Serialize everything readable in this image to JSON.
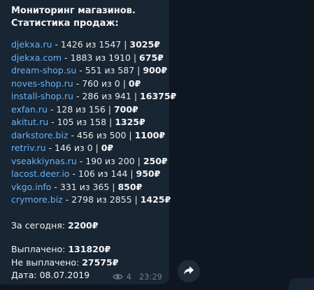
{
  "message": {
    "title": "Мониторинг магазинов.",
    "subtitle": "Статистика продаж:",
    "shops": [
      {
        "name": "djekxa.ru",
        "stats": " - 1426 из 1547 | ",
        "amount": "3025₽"
      },
      {
        "name": "djekxa.com",
        "stats": " - 1883 из 1910 | ",
        "amount": "675₽"
      },
      {
        "name": "dream-shop.su",
        "stats": " - 551 из 587 | ",
        "amount": "900₽"
      },
      {
        "name": "noves-shop.ru",
        "stats": " - 760 из 0 | ",
        "amount": "0₽"
      },
      {
        "name": "install-shop.ru",
        "stats": " - 286 из 941 | ",
        "amount": "16375₽"
      },
      {
        "name": "exfan.ru",
        "stats": " - 128 из 156 | ",
        "amount": "700₽"
      },
      {
        "name": "akitut.ru",
        "stats": " - 105 из 158 | ",
        "amount": "1325₽"
      },
      {
        "name": "darkstore.biz",
        "stats": " - 456 из 500 | ",
        "amount": "1100₽"
      },
      {
        "name": "retriv.ru",
        "stats": " - 146 из 0 | ",
        "amount": "0₽"
      },
      {
        "name": "vseakkiynas.ru",
        "stats": " - 190 из 200 | ",
        "amount": "250₽"
      },
      {
        "name": "lacost.deer.io",
        "stats": " - 106 из 144 | ",
        "amount": "950₽"
      },
      {
        "name": "vkgo.info",
        "stats": " - 331 из 365 | ",
        "amount": "850₽"
      },
      {
        "name": "crymore.biz",
        "stats": " - 2798 из 2855 | ",
        "amount": "1425₽"
      }
    ],
    "today_label": "За сегодня: ",
    "today_value": "2200₽",
    "paid_label": "Выплачено: ",
    "paid_value": "131820₽",
    "unpaid_label": "Не выплачено: ",
    "unpaid_value": "27575₽",
    "date_label": "Дата: ",
    "date_value": "08.07.2019",
    "views": "4",
    "time": "23:29"
  },
  "icons": {
    "views": "eye-icon",
    "forward": "share-arrow-icon"
  },
  "colors": {
    "background": "#0e1621",
    "bubble": "#182533",
    "link": "#6ab2f2",
    "meta": "#6d7f8f"
  }
}
